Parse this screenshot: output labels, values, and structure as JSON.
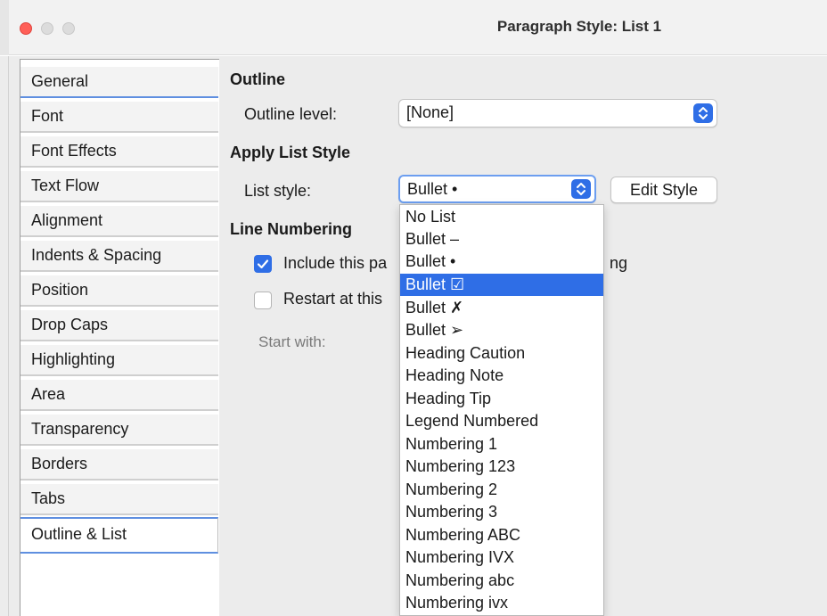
{
  "window": {
    "title": "Paragraph Style: List 1"
  },
  "sidebar": {
    "tabs": [
      {
        "label": "General"
      },
      {
        "label": "Font"
      },
      {
        "label": "Font Effects"
      },
      {
        "label": "Text Flow"
      },
      {
        "label": "Alignment"
      },
      {
        "label": "Indents & Spacing"
      },
      {
        "label": "Position"
      },
      {
        "label": "Drop Caps"
      },
      {
        "label": "Highlighting"
      },
      {
        "label": "Area"
      },
      {
        "label": "Transparency"
      },
      {
        "label": "Borders"
      },
      {
        "label": "Tabs"
      },
      {
        "label": "Outline & List"
      }
    ],
    "selected": "Outline & List"
  },
  "outline": {
    "heading": "Outline",
    "level_label": "Outline level:",
    "level_value": "[None]"
  },
  "apply_list_style": {
    "heading": "Apply List Style",
    "list_style_label": "List style:",
    "list_style_value": "Bullet •",
    "edit_style_button": "Edit Style"
  },
  "line_numbering": {
    "heading": "Line Numbering",
    "include_label": "Include this pa",
    "include_label_tail": "ng",
    "include_checked": true,
    "restart_label": "Restart at this",
    "restart_checked": false,
    "start_with_label": "Start with:"
  },
  "list_style_dropdown": {
    "options": [
      "No List",
      "Bullet –",
      "Bullet •",
      "Bullet ☑",
      "Bullet ✗",
      "Bullet ➢",
      "Heading Caution",
      "Heading Note",
      "Heading Tip",
      "Legend Numbered",
      "Numbering 1",
      "Numbering 123",
      "Numbering 2",
      "Numbering 3",
      "Numbering ABC",
      "Numbering IVX",
      "Numbering abc",
      "Numbering ivx"
    ],
    "highlighted": "Bullet ☑"
  },
  "colors": {
    "accent": "#2f6ee6",
    "close_button": "#ff5f57",
    "tab_selected_border": "#5f8fe0"
  },
  "icons": {
    "select_stepper": "chevron-up-down-icon",
    "checkbox_check": "checkmark-icon"
  }
}
